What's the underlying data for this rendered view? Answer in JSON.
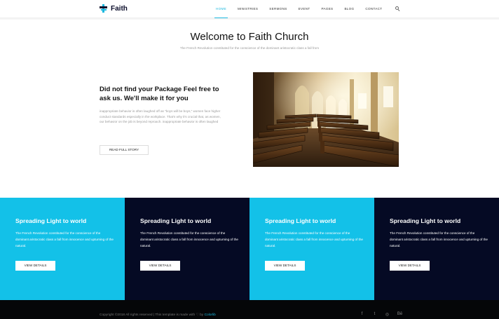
{
  "brand": {
    "name": "Faith"
  },
  "nav": {
    "items": [
      {
        "label": "HOME"
      },
      {
        "label": "MINISTRIES"
      },
      {
        "label": "SERMONS"
      },
      {
        "label": "EVENT"
      },
      {
        "label": "PAGES"
      },
      {
        "label": "BLOG"
      },
      {
        "label": "CONTACT"
      }
    ],
    "active_index": 0
  },
  "welcome": {
    "title": "Welcome to Faith Church",
    "subtitle": "The French Revolution constituted for the conscience of the dominant aristocratic class a fall from"
  },
  "about": {
    "heading": "Did not find your Package Feel free to ask us. We'll make it for you",
    "text": "inappropriate behavior is often laughed off as “boys will be boys,” women face higher conduct standards especially in the workplace. That’s why it’s crucial that, as women, our behavior on the job is beyond reproach. inappropriate behavior is often laughed",
    "button_label": "READ FULL STORY"
  },
  "cards": [
    {
      "title": "Spreading Light to world",
      "text": "The French Revolution constituted for the conscience of the dominant aristocratic class a fall from innocence and upturning of the natural.",
      "button_label": "VIEW DETAILS",
      "style": "light"
    },
    {
      "title": "Spreading Light to world",
      "text": "The French Revolution constituted for the conscience of the dominant aristocratic class a fall from innocence and upturning of the natural.",
      "button_label": "VIEW DETAILS",
      "style": "dark"
    },
    {
      "title": "Spreading Light to world",
      "text": "The French Revolution constituted for the conscience of the dominant aristocratic class a fall from innocence and upturning of the natural.",
      "button_label": "VIEW DETAILS",
      "style": "light"
    },
    {
      "title": "Spreading Light to world",
      "text": "The French Revolution constituted for the conscience of the dominant aristocratic class a fall from innocence and upturning of the natural.",
      "button_label": "VIEW DETAILS",
      "style": "dark"
    }
  ],
  "footer": {
    "copyright_prefix": "Copyright ©2018 All rights reserved | This template is made with",
    "copyright_by": "by",
    "copyright_brand": "Colorlib",
    "socials": [
      {
        "icon": "facebook-icon",
        "glyph": "f"
      },
      {
        "icon": "twitter-icon",
        "glyph": "t"
      },
      {
        "icon": "dribbble-icon",
        "glyph": "◎"
      },
      {
        "icon": "behance-icon",
        "glyph": "Bē"
      }
    ]
  },
  "colors": {
    "accent": "#1ab7de",
    "card_light": "#13c1e8",
    "card_dark": "#050a24",
    "footer": "#050608"
  }
}
